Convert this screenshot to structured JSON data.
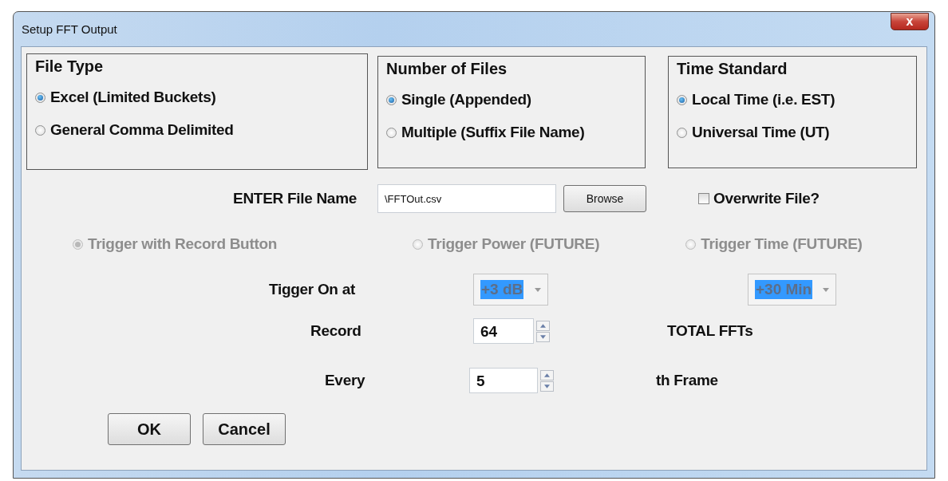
{
  "window": {
    "title": "Setup FFT Output",
    "close": "x"
  },
  "groups": [
    {
      "title": "File Type",
      "options": [
        {
          "label": "Excel (Limited Buckets)",
          "selected": true
        },
        {
          "label": "General Comma Delimited",
          "selected": false
        }
      ]
    },
    {
      "title": "Number of Files",
      "options": [
        {
          "label": "Single (Appended)",
          "selected": true
        },
        {
          "label": "Multiple (Suffix File Name)",
          "selected": false
        }
      ]
    },
    {
      "title": "Time Standard",
      "options": [
        {
          "label": "Local Time (i.e. EST)",
          "selected": true
        },
        {
          "label": "Universal Time (UT)",
          "selected": false
        }
      ]
    }
  ],
  "file_name": {
    "label": "ENTER File Name",
    "value": "\\FFTOut.csv",
    "button": "Browse"
  },
  "overwrite": {
    "label": "Overwrite File?",
    "checked": false
  },
  "triggers": [
    {
      "label": "Trigger with Record Button",
      "selected": true,
      "disabled": true
    },
    {
      "label": "Trigger Power (FUTURE)",
      "selected": false,
      "disabled": true
    },
    {
      "label": "Trigger Time (FUTURE)",
      "selected": false,
      "disabled": true
    }
  ],
  "trigger_on": {
    "label": "Tigger On at",
    "combos": [
      {
        "value": "+3 dB",
        "disabled": true
      },
      {
        "value": "+30 Min",
        "disabled": true
      }
    ]
  },
  "record": {
    "label": "Record",
    "value": "64",
    "suffix": "TOTAL FFTs"
  },
  "every": {
    "label": "Every",
    "value": "5",
    "suffix": "th Frame"
  },
  "buttons": [
    "OK",
    "Cancel"
  ]
}
